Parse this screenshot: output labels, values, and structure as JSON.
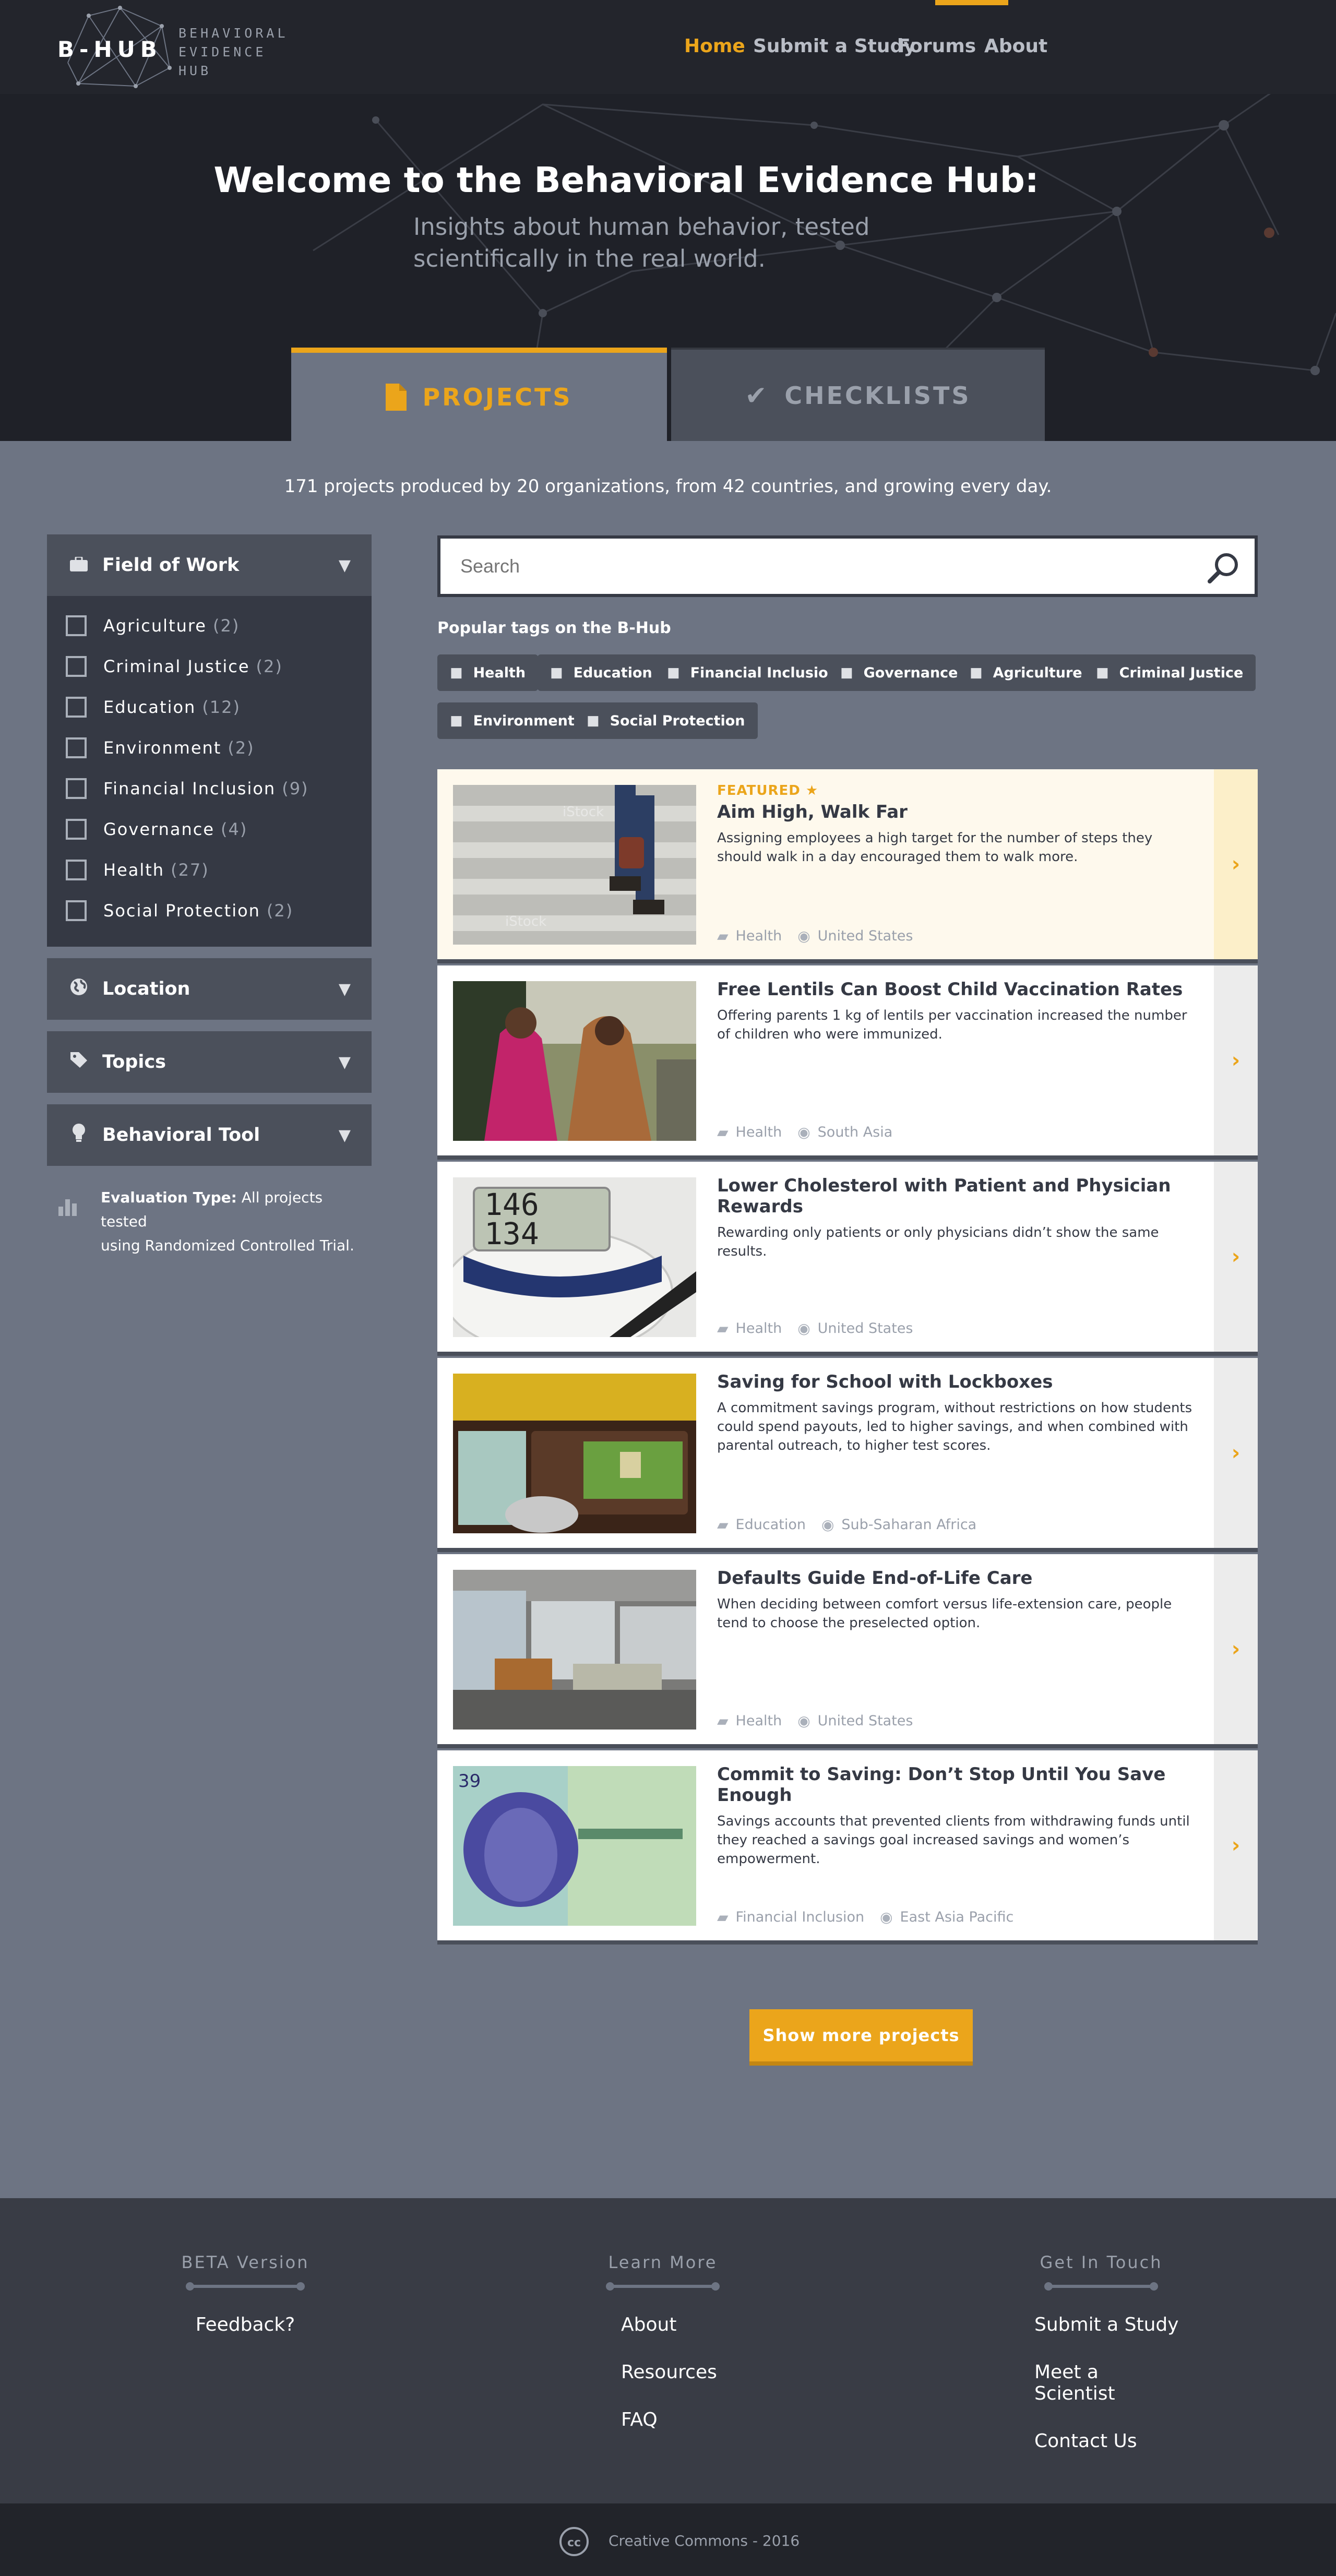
{
  "brand": {
    "logo_text": "B-HUB",
    "sub_lines": [
      "BEHAVIORAL",
      "EVIDENCE",
      "HUB"
    ]
  },
  "nav": {
    "items": [
      {
        "label": "Home",
        "active": true
      },
      {
        "label": "Submit a Study",
        "active": false
      },
      {
        "label": "Forums",
        "active": false
      },
      {
        "label": "About",
        "active": false
      }
    ]
  },
  "hero": {
    "title": "Welcome to the Behavioral Evidence Hub:",
    "subtitle_lines": [
      "Insights about human behavior, tested",
      "scientifically in the real world."
    ]
  },
  "tabs": [
    {
      "label": "PROJECTS",
      "icon": "document-icon",
      "active": true
    },
    {
      "label": "CHECKLISTS",
      "icon": "checkmark-icon",
      "active": false
    }
  ],
  "stats_text": "171 projects produced by 20 organizations, from 42 countries, and growing every day.",
  "sidebar": {
    "field_of_work": {
      "title": "Field of Work",
      "icon": "briefcase-icon",
      "items": [
        {
          "label": "Agriculture",
          "count": "(2)"
        },
        {
          "label": "Criminal Justice",
          "count": "(2)"
        },
        {
          "label": "Education",
          "count": "(12)"
        },
        {
          "label": "Environment",
          "count": "(2)"
        },
        {
          "label": "Financial Inclusion",
          "count": "(9)"
        },
        {
          "label": "Governance",
          "count": "(4)"
        },
        {
          "label": "Health",
          "count": "(27)"
        },
        {
          "label": "Social Protection",
          "count": "(2)"
        }
      ]
    },
    "location": {
      "title": "Location",
      "icon": "globe-icon"
    },
    "topics": {
      "title": "Topics",
      "icon": "tag-icon"
    },
    "behavioral_tool": {
      "title": "Behavioral Tool",
      "icon": "lightbulb-icon"
    },
    "evaluation": {
      "label": "Evaluation Type:",
      "text_line1": " All projects tested",
      "text_line2": "using Randomized Controlled Trial."
    }
  },
  "search": {
    "placeholder": "Search"
  },
  "tags": {
    "title": "Popular tags on the B-Hub",
    "items": [
      "Health",
      "Education",
      "Financial Inclusion",
      "Governance",
      "Agriculture",
      "Criminal Justice",
      "Environment",
      "Social Protection"
    ]
  },
  "projects": [
    {
      "featured_label": "FEATURED",
      "title": "Aim High, Walk Far",
      "desc": "Assigning employees a high target for the number of steps they should walk in a day encouraged them to walk more.",
      "field": "Health",
      "region": "United States"
    },
    {
      "title": "Free Lentils Can Boost Child Vaccination Rates",
      "desc": "Offering parents 1 kg of lentils per vaccination increased the number of children who were immunized.",
      "field": "Health",
      "region": "South Asia"
    },
    {
      "title": "Lower Cholesterol with Patient and Physician Rewards",
      "desc": "Rewarding only patients or only physicians didn’t show the same results.",
      "field": "Health",
      "region": "United States"
    },
    {
      "title": "Saving for School with Lockboxes",
      "desc": "A commitment savings program, without restrictions on how students could spend payouts, led to higher savings, and when combined with parental outreach, to higher test scores.",
      "field": "Education",
      "region": "Sub-Saharan Africa"
    },
    {
      "title": "Defaults Guide End-of-Life Care",
      "desc": "When deciding between comfort versus life-extension care, people tend to choose the preselected option.",
      "field": "Health",
      "region": "United States"
    },
    {
      "title": "Commit to Saving: Don’t Stop Until You Save Enough",
      "desc": "Savings accounts that prevented clients from withdrawing funds until they reached a savings goal increased savings and women’s empowerment.",
      "field": "Financial Inclusion",
      "region": "East Asia Pacific"
    }
  ],
  "thumb_texts": {
    "stock": "iStock",
    "bp_top": "146",
    "bp_bottom": "134",
    "note": "39"
  },
  "show_more_label": "Show more projects",
  "footer": {
    "beta": {
      "heading": "BETA Version",
      "links": [
        "Feedback?"
      ]
    },
    "learn": {
      "heading": "Learn More",
      "links": [
        "About",
        "Resources",
        "FAQ"
      ]
    },
    "touch": {
      "heading": "Get In Touch",
      "links": [
        "Submit a Study",
        "Meet a Scientist",
        "Contact Us"
      ]
    }
  },
  "copyright": "Creative Commons - 2016",
  "colors": {
    "accent": "#eba51b",
    "dark": "#1f2128",
    "panel": "#4b505b",
    "page": "#6d7483"
  }
}
